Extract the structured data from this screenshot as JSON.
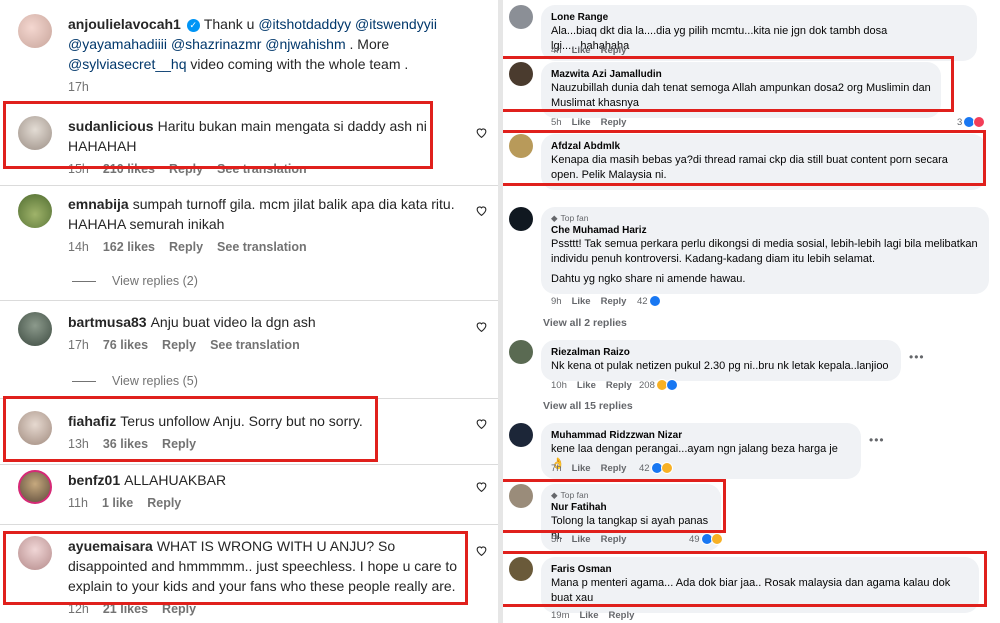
{
  "instagram": {
    "top": {
      "user": "anjoulielavocah1",
      "pre": "Thank u",
      "mentions": [
        "@itshotdaddyy",
        "@itswendyyii",
        "@yayamahadiiii",
        "@shazrinazmr",
        "@njwahishm"
      ],
      "more": ". More",
      "mention2": "@sylviasecret__hq",
      "tail": "video coming with the whole team .",
      "time": "17h"
    },
    "comments": [
      {
        "user": "sudanlicious",
        "text": "Haritu bukan main mengata si daddy ash ni HAHAHAH",
        "time": "15h",
        "likes": "210 likes",
        "reply": "Reply",
        "see": "See translation"
      },
      {
        "user": "emnabija",
        "text": "sumpah turnoff gila. mcm jilat balik apa dia kata ritu. HAHAHA semurah inikah",
        "time": "14h",
        "likes": "162 likes",
        "reply": "Reply",
        "see": "See translation"
      },
      {
        "user": "bartmusa83",
        "text": "Anju buat video la dgn ash",
        "time": "17h",
        "likes": "76 likes",
        "reply": "Reply",
        "see": "See translation"
      },
      {
        "user": "fiahafiz",
        "text": "Terus unfollow Anju. Sorry but no sorry.",
        "time": "13h",
        "likes": "36 likes",
        "reply": "Reply",
        "see": ""
      },
      {
        "user": "benfz01",
        "text": "ALLAHUAKBAR",
        "time": "11h",
        "likes": "1 like",
        "reply": "Reply",
        "see": ""
      },
      {
        "user": "ayuemaisara",
        "text": "WHAT IS WRONG WITH U ANJU? So disappointed and hmmmmm.. just speechless. I hope u care to explain to your kids and your fans who these people really are.",
        "time": "12h",
        "likes": "21 likes",
        "reply": "Reply",
        "see": ""
      }
    ],
    "view_replies": [
      "View replies (2)",
      "View replies (5)"
    ]
  },
  "facebook": {
    "comments": [
      {
        "name": "Lone Range",
        "text": "Ala...biaq dkt dia la....dia yg pilih mcmtu...kita nie jgn dok tambh dosa lgi......hahahaha",
        "time": "4h",
        "like": "Like",
        "reply": "Reply",
        "reactions": ""
      },
      {
        "name": "Mazwita Azi Jamalludin",
        "text": "Nauzubillah dunia dah tenat semoga Allah ampunkan dosa2 org Muslimin dan Muslimat khasnya",
        "time": "5h",
        "like": "Like",
        "reply": "Reply",
        "reactions": "3"
      },
      {
        "name": "Afdzal Abdmlk",
        "text": "Kenapa dia masih bebas ya?di thread ramai ckp dia still buat content porn secara open. Pelik Malaysia ni.",
        "time": "",
        "like": "",
        "reply": "",
        "reactions": ""
      },
      {
        "name": "Che Muhamad Hariz",
        "badge": "Top fan",
        "text": "Pssttt! Tak semua perkara perlu dikongsi di media sosial, lebih-lebih lagi bila melibatkan individu penuh kontroversi. Kadang-kadang diam itu lebih selamat.",
        "text2": "Dahtu yg ngko share ni amende hawau.",
        "time": "9h",
        "like": "Like",
        "reply": "Reply",
        "reactions": "42"
      },
      {
        "name": "Riezalman Raizo",
        "text": "Nk kena ot pulak netizen pukul 2.30 pg ni..bru nk letak kepala..lanjioo",
        "time": "10h",
        "like": "Like",
        "reply": "Reply",
        "reactions": "208"
      },
      {
        "name": "Muhammad Ridzzwan Nizar",
        "text": "kene laa dengan perangai...ayam ngn jalang beza harga je👌",
        "time": "7h",
        "like": "Like",
        "reply": "Reply",
        "reactions": "42"
      },
      {
        "name": "Nur Fatihah",
        "badge": "Top fan",
        "text": "Tolong la tangkap si ayah panas ni.",
        "time": "5h",
        "like": "Like",
        "reply": "Reply",
        "reactions": "49"
      },
      {
        "name": "Faris Osman",
        "text": "Mana p menteri agama... Ada dok biar jaa.. Rosak malaysia dan agama kalau dok buat xau",
        "time": "19m",
        "like": "Like",
        "reply": "Reply",
        "reactions": ""
      }
    ],
    "view_all": [
      "View all 2 replies",
      "View all 15 replies"
    ]
  },
  "colors": {
    "highlight": "#e0201c",
    "bubble": "#f0f2f5",
    "fb_like": "#1877f2"
  }
}
